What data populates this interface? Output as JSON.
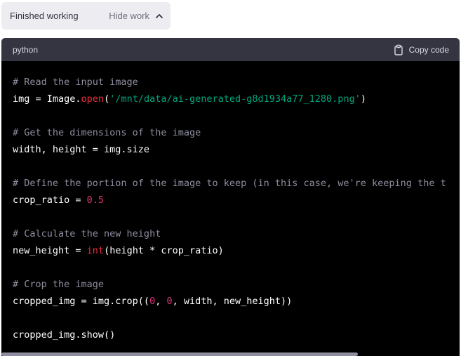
{
  "status": {
    "text": "Finished working",
    "toggle_label": "Hide work",
    "toggle_icon": "chevron-up-icon"
  },
  "code_block": {
    "language": "python",
    "copy_label": "Copy code",
    "copy_icon": "clipboard-icon",
    "lines": [
      [
        {
          "t": "comment",
          "v": "# Read the input image"
        }
      ],
      [
        {
          "t": "plain",
          "v": "img = Image."
        },
        {
          "t": "func",
          "v": "open"
        },
        {
          "t": "plain",
          "v": "("
        },
        {
          "t": "string",
          "v": "'/mnt/data/ai-generated-g8d1934a77_1280.png'"
        },
        {
          "t": "plain",
          "v": ")"
        }
      ],
      [],
      [
        {
          "t": "comment",
          "v": "# Get the dimensions of the image"
        }
      ],
      [
        {
          "t": "plain",
          "v": "width, height = img.size"
        }
      ],
      [],
      [
        {
          "t": "comment",
          "v": "# Define the portion of the image to keep (in this case, we're keeping the t"
        }
      ],
      [
        {
          "t": "plain",
          "v": "crop_ratio = "
        },
        {
          "t": "number",
          "v": "0.5"
        }
      ],
      [],
      [
        {
          "t": "comment",
          "v": "# Calculate the new height"
        }
      ],
      [
        {
          "t": "plain",
          "v": "new_height = "
        },
        {
          "t": "builtin",
          "v": "int"
        },
        {
          "t": "plain",
          "v": "(height * crop_ratio)"
        }
      ],
      [],
      [
        {
          "t": "comment",
          "v": "# Crop the image"
        }
      ],
      [
        {
          "t": "plain",
          "v": "cropped_img = img.crop(("
        },
        {
          "t": "number",
          "v": "0"
        },
        {
          "t": "plain",
          "v": ", "
        },
        {
          "t": "number",
          "v": "0"
        },
        {
          "t": "plain",
          "v": ", width, new_height))"
        }
      ],
      [],
      [
        {
          "t": "plain",
          "v": "cropped_img.show()"
        }
      ]
    ]
  },
  "colors": {
    "header_bg": "#343541",
    "code_bg": "#000000",
    "comment": "#8e8ea0",
    "string": "#00a67d",
    "number": "#df3079",
    "function": "#f22c3d"
  }
}
